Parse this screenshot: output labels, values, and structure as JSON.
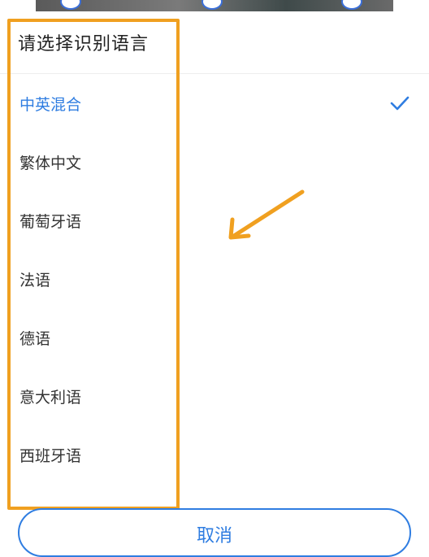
{
  "dialog": {
    "title": "请选择识别语言",
    "languages": [
      {
        "label": "中英混合",
        "selected": true
      },
      {
        "label": "繁体中文",
        "selected": false
      },
      {
        "label": "葡萄牙语",
        "selected": false
      },
      {
        "label": "法语",
        "selected": false
      },
      {
        "label": "德语",
        "selected": false
      },
      {
        "label": "意大利语",
        "selected": false
      },
      {
        "label": "西班牙语",
        "selected": false
      }
    ],
    "cancel_label": "取消"
  },
  "colors": {
    "accent": "#2f7de1",
    "highlight": "#f0a020",
    "text": "#333333"
  },
  "icons": {
    "selected": "checkmark-icon",
    "annotation": "arrow-icon"
  }
}
